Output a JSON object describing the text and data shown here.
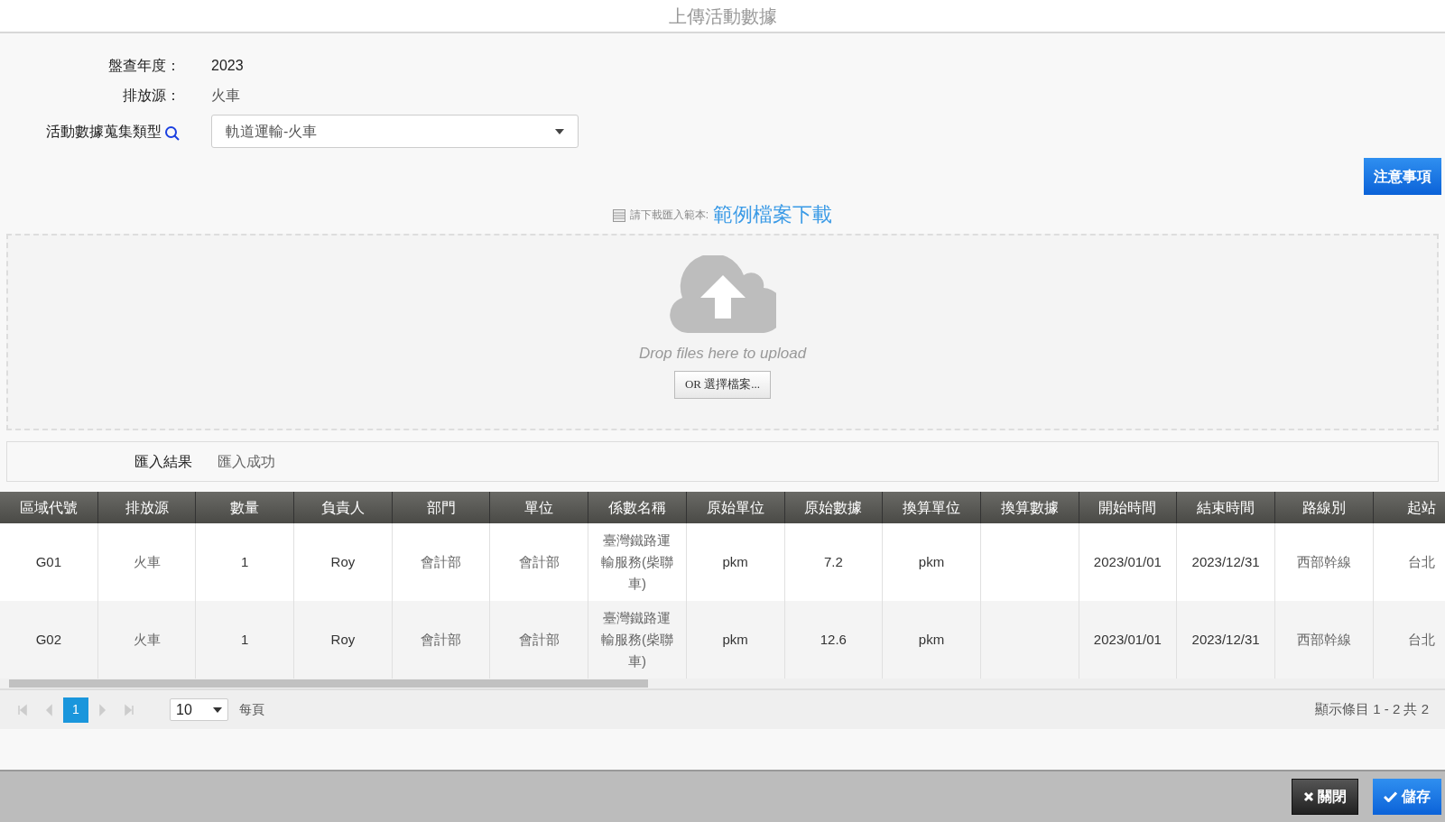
{
  "window": {
    "title": "上傳活動數據"
  },
  "form": {
    "fields": [
      {
        "label": "盤查年度：",
        "value": "2023",
        "kind": "text"
      },
      {
        "label": "排放源：",
        "value": "火車",
        "kind": "text"
      },
      {
        "label": "活動數據蒐集類型",
        "value": "軌道運輸-火車",
        "kind": "select"
      }
    ]
  },
  "notice_button": "注意事項",
  "template": {
    "hint": "請下載匯入範本:",
    "link": "範例檔案下載"
  },
  "upload": {
    "prompt": "Drop files here to upload",
    "button": "OR 選擇檔案..."
  },
  "import_result": {
    "label": "匯入結果",
    "value": "匯入成功"
  },
  "table": {
    "columns": [
      "區域代號",
      "排放源",
      "數量",
      "負責人",
      "部門",
      "單位",
      "係數名稱",
      "原始單位",
      "原始數據",
      "換算單位",
      "換算數據",
      "開始時間",
      "結束時間",
      "路線別",
      "起站"
    ],
    "rows": [
      {
        "cells": [
          "G01",
          "火車",
          "1",
          "Roy",
          "會計部",
          "會計部",
          "臺灣鐵路運輸服務(柴聯車)",
          "pkm",
          "7.2",
          "pkm",
          "",
          "2023/01/01",
          "2023/12/31",
          "西部幹線",
          "台北"
        ]
      },
      {
        "cells": [
          "G02",
          "火車",
          "1",
          "Roy",
          "會計部",
          "會計部",
          "臺灣鐵路運輸服務(柴聯車)",
          "pkm",
          "12.6",
          "pkm",
          "",
          "2023/01/01",
          "2023/12/31",
          "西部幹線",
          "台北"
        ]
      }
    ]
  },
  "pager": {
    "pages": [
      {
        "label": "1",
        "selected": true
      }
    ],
    "page_size": "10",
    "per_page_label": "每頁",
    "summary": "顯示條目 1 - 2 共 2"
  },
  "footer": {
    "buttons": [
      {
        "label": "關閉",
        "kind": "close"
      },
      {
        "label": "儲存",
        "kind": "save"
      }
    ]
  }
}
